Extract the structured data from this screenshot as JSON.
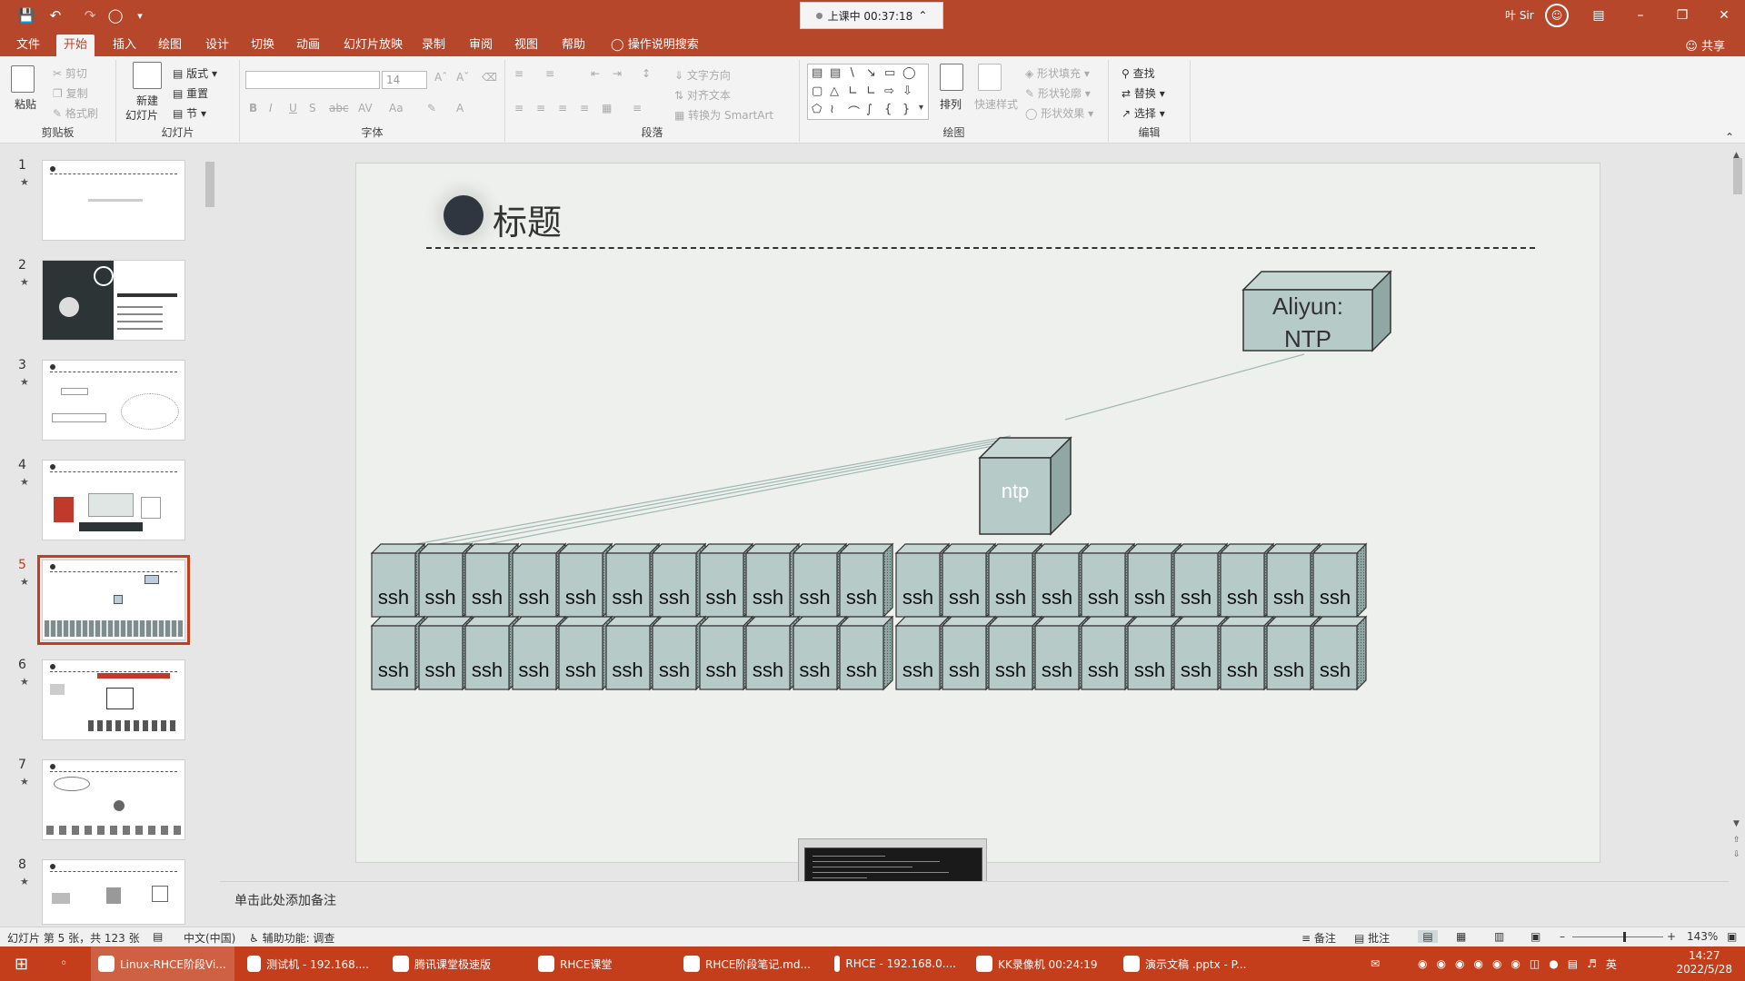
{
  "titlebar": {
    "recording_label": "上课中 00:37:18",
    "user_name": "叶 Sir",
    "colors": {
      "accent": "#b7472a",
      "taskbar": "#c43e1c",
      "selected_thumb": "#c43e1c"
    }
  },
  "menu": {
    "tabs": [
      "文件",
      "开始",
      "插入",
      "绘图",
      "设计",
      "切换",
      "动画",
      "幻灯片放映",
      "录制",
      "审阅",
      "视图",
      "帮助"
    ],
    "active_tab": "开始",
    "tell_me": "操作说明搜索",
    "share": "共享"
  },
  "ribbon": {
    "clipboard": {
      "paste": "粘贴",
      "cut": "剪切",
      "copy": "复制",
      "format_painter": "格式刷",
      "label": "剪贴板"
    },
    "slides": {
      "new_slide_line1": "新建",
      "new_slide_line2": "幻灯片",
      "layout": "版式",
      "reset": "重置",
      "section": "节",
      "label": "幻灯片"
    },
    "font": {
      "size": "14",
      "label": "字体"
    },
    "paragraph": {
      "text_direction": "文字方向",
      "align_text": "对齐文本",
      "smartart": "转换为 SmartArt",
      "label": "段落"
    },
    "drawing": {
      "arrange": "排列",
      "quick_styles": "快速样式",
      "shape_fill": "形状填充",
      "shape_outline": "形状轮廓",
      "shape_effects": "形状效果",
      "label": "绘图"
    },
    "editing": {
      "find": "查找",
      "replace": "替换",
      "select": "选择",
      "label": "编辑"
    }
  },
  "thumbnails": [
    {
      "num": "1",
      "star": "★"
    },
    {
      "num": "2",
      "star": "★"
    },
    {
      "num": "3",
      "star": "★"
    },
    {
      "num": "4",
      "star": "★"
    },
    {
      "num": "5",
      "star": "★"
    },
    {
      "num": "6",
      "star": "★"
    },
    {
      "num": "7",
      "star": "★"
    },
    {
      "num": "8",
      "star": "★"
    }
  ],
  "selected_slide": "5",
  "slide": {
    "title": "标题",
    "aliyun_label_line1": "Aliyun:",
    "aliyun_label_line2": "NTP",
    "ntp_label": "ntp",
    "ssh_label": "ssh",
    "ssh_rows": 2,
    "ssh_per_group": 11,
    "ssh_right_group": 10
  },
  "notes_placeholder": "单击此处添加备注",
  "statusbar": {
    "slide_info": "幻灯片 第 5 张，共 123 张",
    "language": "中文(中国)",
    "accessibility": "辅助功能: 调查",
    "notes": "备注",
    "comments": "批注",
    "zoom": "143%"
  },
  "taskbar": {
    "items": [
      "Linux-RHCE阶段Vi...",
      "测试机 - 192.168....",
      "腾讯课堂极速版",
      "RHCE课堂",
      "RHCE阶段笔记.md...",
      "RHCE - 192.168.0....",
      "KK录像机 00:24:19",
      "演示文稿 .pptx - P..."
    ],
    "time": "14:27",
    "date": "2022/5/28",
    "ime": "英"
  }
}
